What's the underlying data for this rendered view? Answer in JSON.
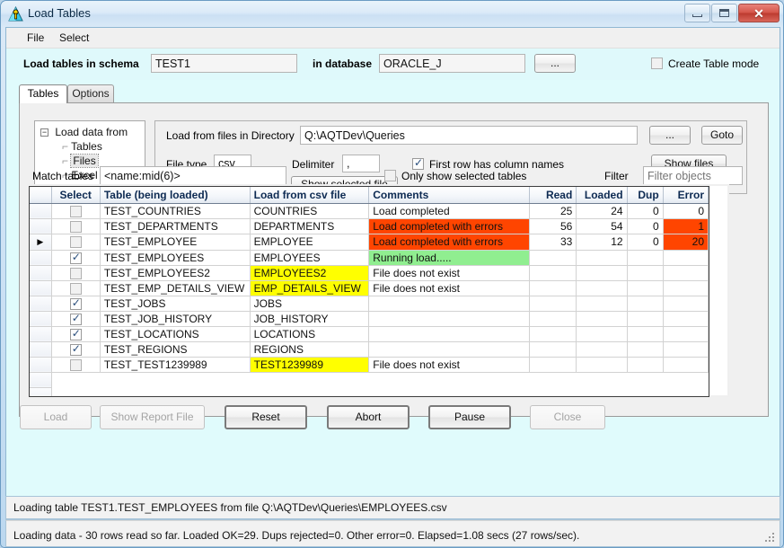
{
  "window": {
    "title": "Load Tables",
    "icon": "app-icon",
    "buttons": {
      "minimize": "–",
      "maximize": "□",
      "close": "✕"
    }
  },
  "menu": {
    "items": [
      {
        "label": "File"
      },
      {
        "label": "Select"
      }
    ]
  },
  "header": {
    "schema_label": "Load tables in schema",
    "schema_value": "TEST1",
    "database_label": "in database",
    "database_value": "ORACLE_J",
    "browse_label": "...",
    "create_table_mode_label": "Create Table mode",
    "create_table_mode_checked": false
  },
  "tabs": [
    {
      "label": "Tables",
      "active": true
    },
    {
      "label": "Options",
      "active": false
    }
  ],
  "source_panel": {
    "tree": {
      "root": "Load data from",
      "expander": "−",
      "children": [
        {
          "label": "Tables",
          "selected": false
        },
        {
          "label": "Files",
          "selected": true
        },
        {
          "label": "Excel File",
          "selected": false
        }
      ]
    },
    "directory_label": "Load from files in Directory",
    "directory_value": "Q:\\AQTDev\\Queries",
    "filetype_label": "File type",
    "filetype_value": "csv",
    "delimiter_label": "Delimiter",
    "delimiter_value": ",",
    "first_row_label": "First row has column names",
    "first_row_checked": true,
    "show_selected_file_label": "Show selected file",
    "browse_label": "...",
    "goto_label": "Goto",
    "show_files_label": "Show files"
  },
  "filters": {
    "match_tables_label": "Match tables",
    "match_tables_value": "<name:mid(6)>",
    "only_selected_label": "Only show selected tables",
    "only_selected_checked": false,
    "filter_label": "Filter",
    "filter_placeholder": "Filter objects"
  },
  "grid": {
    "columns": [
      {
        "key": "rowhdr",
        "label": "",
        "width": 24,
        "align": "center"
      },
      {
        "key": "select",
        "label": "Select",
        "width": 54,
        "align": "center"
      },
      {
        "key": "table",
        "label": "Table (being loaded)",
        "width": 166,
        "align": "left"
      },
      {
        "key": "file",
        "label": "Load from csv file",
        "width": 132,
        "align": "left"
      },
      {
        "key": "comments",
        "label": "Comments",
        "width": 178,
        "align": "left"
      },
      {
        "key": "read",
        "label": "Read",
        "width": 52,
        "align": "right"
      },
      {
        "key": "loaded",
        "label": "Loaded",
        "width": 56,
        "align": "right"
      },
      {
        "key": "dup",
        "label": "Dup",
        "width": 40,
        "align": "right"
      },
      {
        "key": "error",
        "label": "Error",
        "width": 50,
        "align": "right"
      }
    ],
    "rows": [
      {
        "indicator": "",
        "checked": false,
        "table": "TEST_COUNTRIES",
        "file": "COUNTRIES",
        "file_hl": "none",
        "comments": "Load completed",
        "comments_hl": "none",
        "read": "25",
        "loaded": "24",
        "dup": "0",
        "error": "0",
        "error_hl": "none"
      },
      {
        "indicator": "",
        "checked": false,
        "table": "TEST_DEPARTMENTS",
        "file": "DEPARTMENTS",
        "file_hl": "none",
        "comments": "Load completed with errors",
        "comments_hl": "orange",
        "read": "56",
        "loaded": "54",
        "dup": "0",
        "error": "1",
        "error_hl": "orange"
      },
      {
        "indicator": "▶",
        "checked": false,
        "table": "TEST_EMPLOYEE",
        "file": "EMPLOYEE",
        "file_hl": "none",
        "comments": "Load completed with errors",
        "comments_hl": "orange",
        "read": "33",
        "loaded": "12",
        "dup": "0",
        "error": "20",
        "error_hl": "orange"
      },
      {
        "indicator": "",
        "checked": true,
        "table": "TEST_EMPLOYEES",
        "file": "EMPLOYEES",
        "file_hl": "none",
        "comments": "Running load.....",
        "comments_hl": "green",
        "read": "",
        "loaded": "",
        "dup": "",
        "error": "",
        "error_hl": "none"
      },
      {
        "indicator": "",
        "checked": false,
        "table": "TEST_EMPLOYEES2",
        "file": "EMPLOYEES2",
        "file_hl": "yellow",
        "comments": "File does not exist",
        "comments_hl": "none",
        "read": "",
        "loaded": "",
        "dup": "",
        "error": "",
        "error_hl": "none"
      },
      {
        "indicator": "",
        "checked": false,
        "table": "TEST_EMP_DETAILS_VIEW",
        "file": "EMP_DETAILS_VIEW",
        "file_hl": "yellow",
        "comments": "File does not exist",
        "comments_hl": "none",
        "read": "",
        "loaded": "",
        "dup": "",
        "error": "",
        "error_hl": "none"
      },
      {
        "indicator": "",
        "checked": true,
        "table": "TEST_JOBS",
        "file": "JOBS",
        "file_hl": "none",
        "comments": "",
        "comments_hl": "none",
        "read": "",
        "loaded": "",
        "dup": "",
        "error": "",
        "error_hl": "none"
      },
      {
        "indicator": "",
        "checked": true,
        "table": "TEST_JOB_HISTORY",
        "file": "JOB_HISTORY",
        "file_hl": "none",
        "comments": "",
        "comments_hl": "none",
        "read": "",
        "loaded": "",
        "dup": "",
        "error": "",
        "error_hl": "none"
      },
      {
        "indicator": "",
        "checked": true,
        "table": "TEST_LOCATIONS",
        "file": "LOCATIONS",
        "file_hl": "none",
        "comments": "",
        "comments_hl": "none",
        "read": "",
        "loaded": "",
        "dup": "",
        "error": "",
        "error_hl": "none"
      },
      {
        "indicator": "",
        "checked": true,
        "table": "TEST_REGIONS",
        "file": "REGIONS",
        "file_hl": "none",
        "comments": "",
        "comments_hl": "none",
        "read": "",
        "loaded": "",
        "dup": "",
        "error": "",
        "error_hl": "none"
      },
      {
        "indicator": "",
        "checked": false,
        "table": "TEST_TEST1239989",
        "file": "TEST1239989",
        "file_hl": "yellow",
        "comments": "File does not exist",
        "comments_hl": "none",
        "read": "",
        "loaded": "",
        "dup": "",
        "error": "",
        "error_hl": "none"
      }
    ]
  },
  "actions": [
    {
      "label": "Load",
      "disabled": true
    },
    {
      "label": "Show Report File",
      "disabled": true
    },
    {
      "label": "Reset",
      "disabled": false
    },
    {
      "label": "Abort",
      "disabled": false
    },
    {
      "label": "Pause",
      "disabled": false
    },
    {
      "label": "Close",
      "disabled": true
    }
  ],
  "status": {
    "line1": "Loading table TEST1.TEST_EMPLOYEES from file Q:\\AQTDev\\Queries\\EMPLOYEES.csv",
    "line2": "Loading data - 30 rows read so far. Loaded OK=29. Dups rejected=0. Other error=0. Elapsed=1.08 secs (27 rows/sec)."
  },
  "colors": {
    "error_bg": "#ff4500",
    "running_bg": "#90ee90",
    "missing_file_bg": "#ffff00",
    "client_bg": "#e0fbfc",
    "header_text": "#0d2a52"
  }
}
